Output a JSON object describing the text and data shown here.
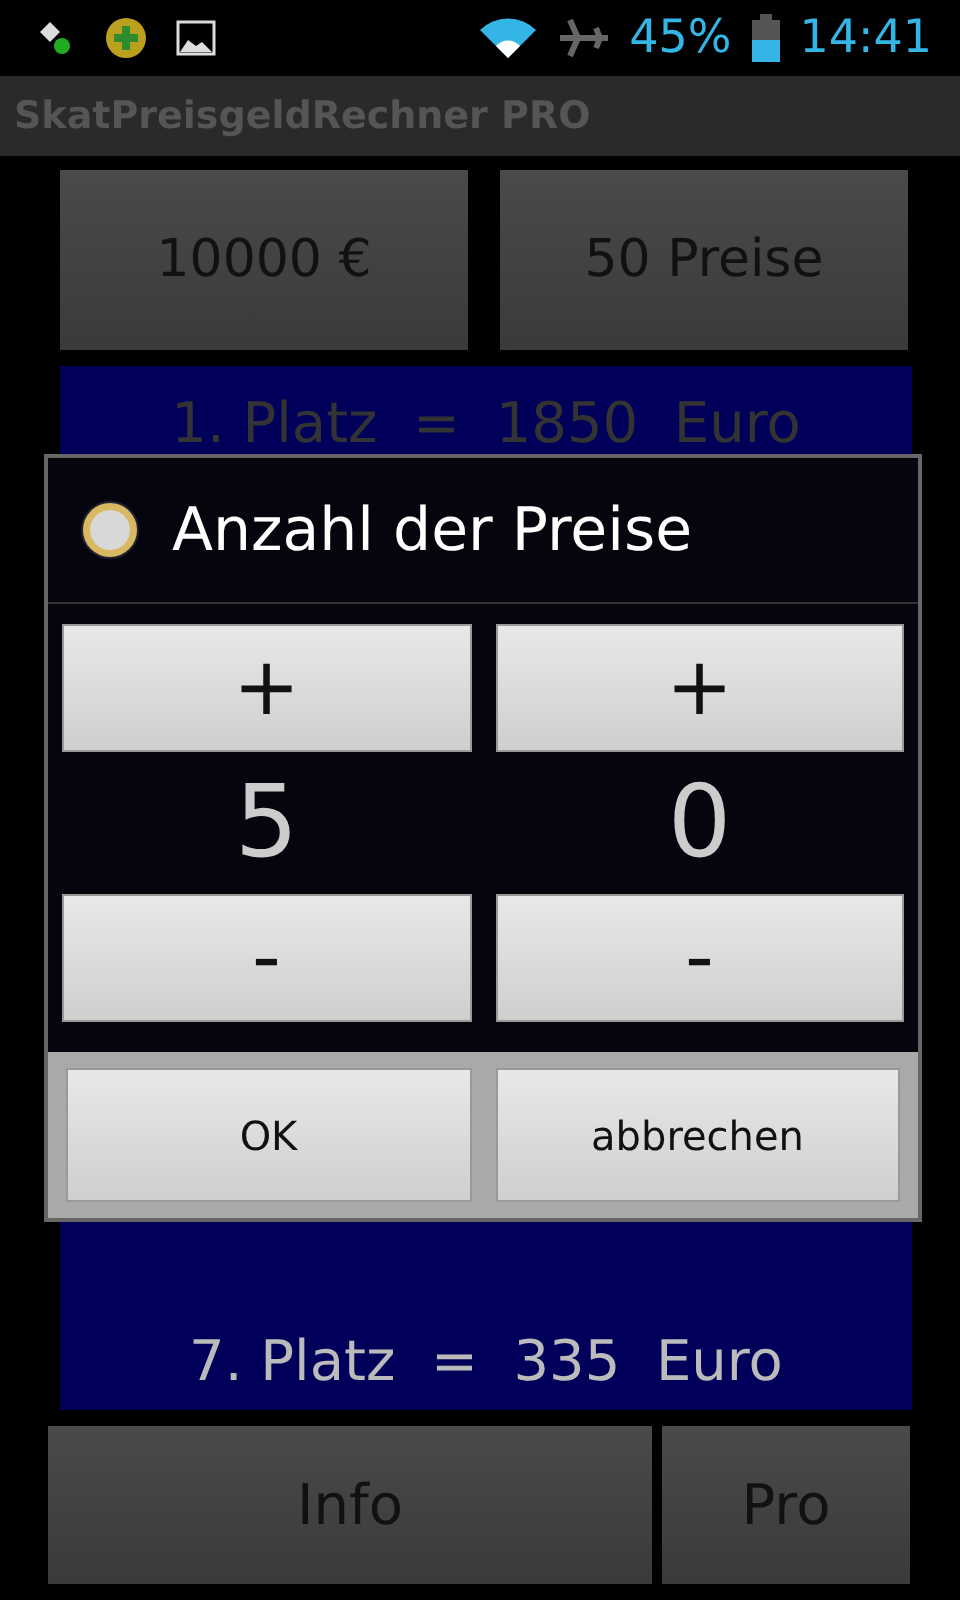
{
  "status_bar": {
    "battery": "45%",
    "time": "14:41"
  },
  "app_title": "SkatPreisgeldRechner PRO",
  "top_buttons": [
    "10000 €",
    "50 Preise"
  ],
  "prize_list": [
    "1. Platz  =  1850  Euro",
    "7. Platz  =  335  Euro"
  ],
  "dialog": {
    "title": "Anzahl der Preise",
    "digits": [
      {
        "plus": "+",
        "value": "5",
        "minus": "-"
      },
      {
        "plus": "+",
        "value": "0",
        "minus": "-"
      }
    ],
    "buttons": [
      "OK",
      "abbrechen"
    ]
  },
  "bottom_buttons": [
    "Info",
    "Pro"
  ]
}
